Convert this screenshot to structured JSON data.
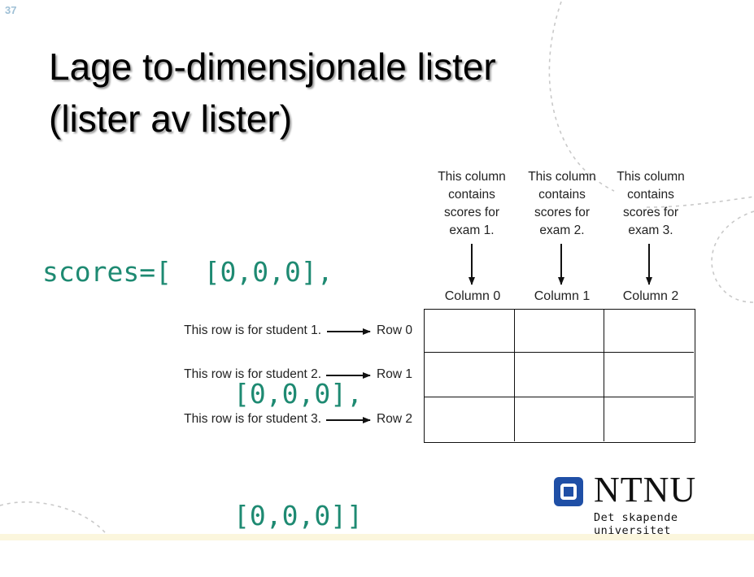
{
  "slide": {
    "number": "37"
  },
  "title": {
    "line1": "Lage to-dimensjonale lister",
    "line2": "(lister av lister)"
  },
  "code": {
    "line1": "scores=[  [0,0,0],",
    "line2": "[0,0,0],",
    "line3": "[0,0,0]]",
    "color": "#1e8a72"
  },
  "figure": {
    "column_descriptions": [
      [
        "This column",
        "contains",
        "scores for",
        "exam 1."
      ],
      [
        "This column",
        "contains",
        "scores for",
        "exam 2."
      ],
      [
        "This column",
        "contains",
        "scores for",
        "exam 3."
      ]
    ],
    "column_labels": [
      "Column 0",
      "Column 1",
      "Column 2"
    ],
    "row_descriptions": [
      "This row is for student 1.",
      "This row is for student 2.",
      "This row is for student 3."
    ],
    "row_labels": [
      "Row 0",
      "Row 1",
      "Row 2"
    ]
  },
  "logo": {
    "name": "NTNU",
    "tagline": "Det skapende universitet",
    "color": "#1f4fa6"
  }
}
